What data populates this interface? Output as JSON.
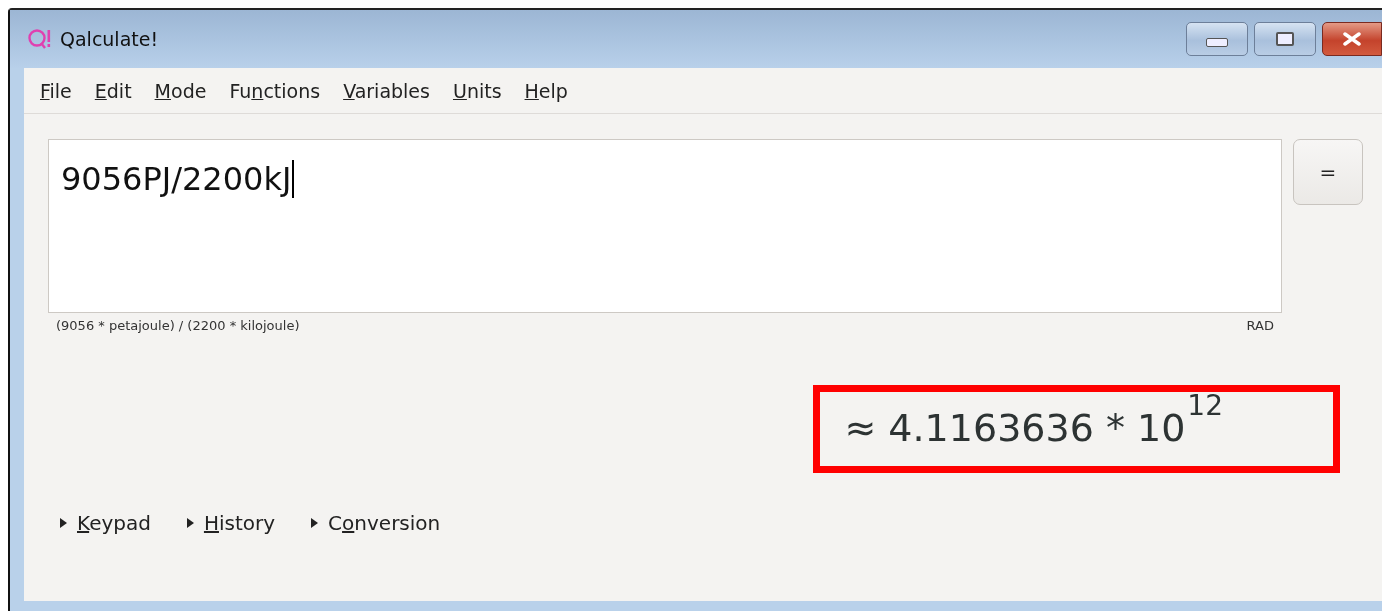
{
  "window": {
    "title": "Qalculate!"
  },
  "menu": [
    {
      "key": "F",
      "after": "ile"
    },
    {
      "key": "E",
      "after": "dit"
    },
    {
      "key": "M",
      "after": "ode"
    },
    {
      "before": "Fu",
      "key": "n",
      "after": "ctions"
    },
    {
      "key": "V",
      "after": "ariables"
    },
    {
      "key": "U",
      "after": "nits"
    },
    {
      "key": "H",
      "after": "elp"
    }
  ],
  "expression": {
    "value": "9056PJ/2200kJ"
  },
  "equals_button": "=",
  "parsed": "(9056 * petajoule) / (2200 * kilojoule)",
  "angle_mode": "RAD",
  "result": {
    "text": "≈ 4.1163636 * 10$^{12}$",
    "highlighted": true
  },
  "expanders": [
    {
      "key": "K",
      "after": "eypad",
      "expanded": false
    },
    {
      "key": "H",
      "after": "istory",
      "expanded": false
    },
    {
      "before": "C",
      "key": "o",
      "after": "nversion",
      "expanded": false
    }
  ]
}
